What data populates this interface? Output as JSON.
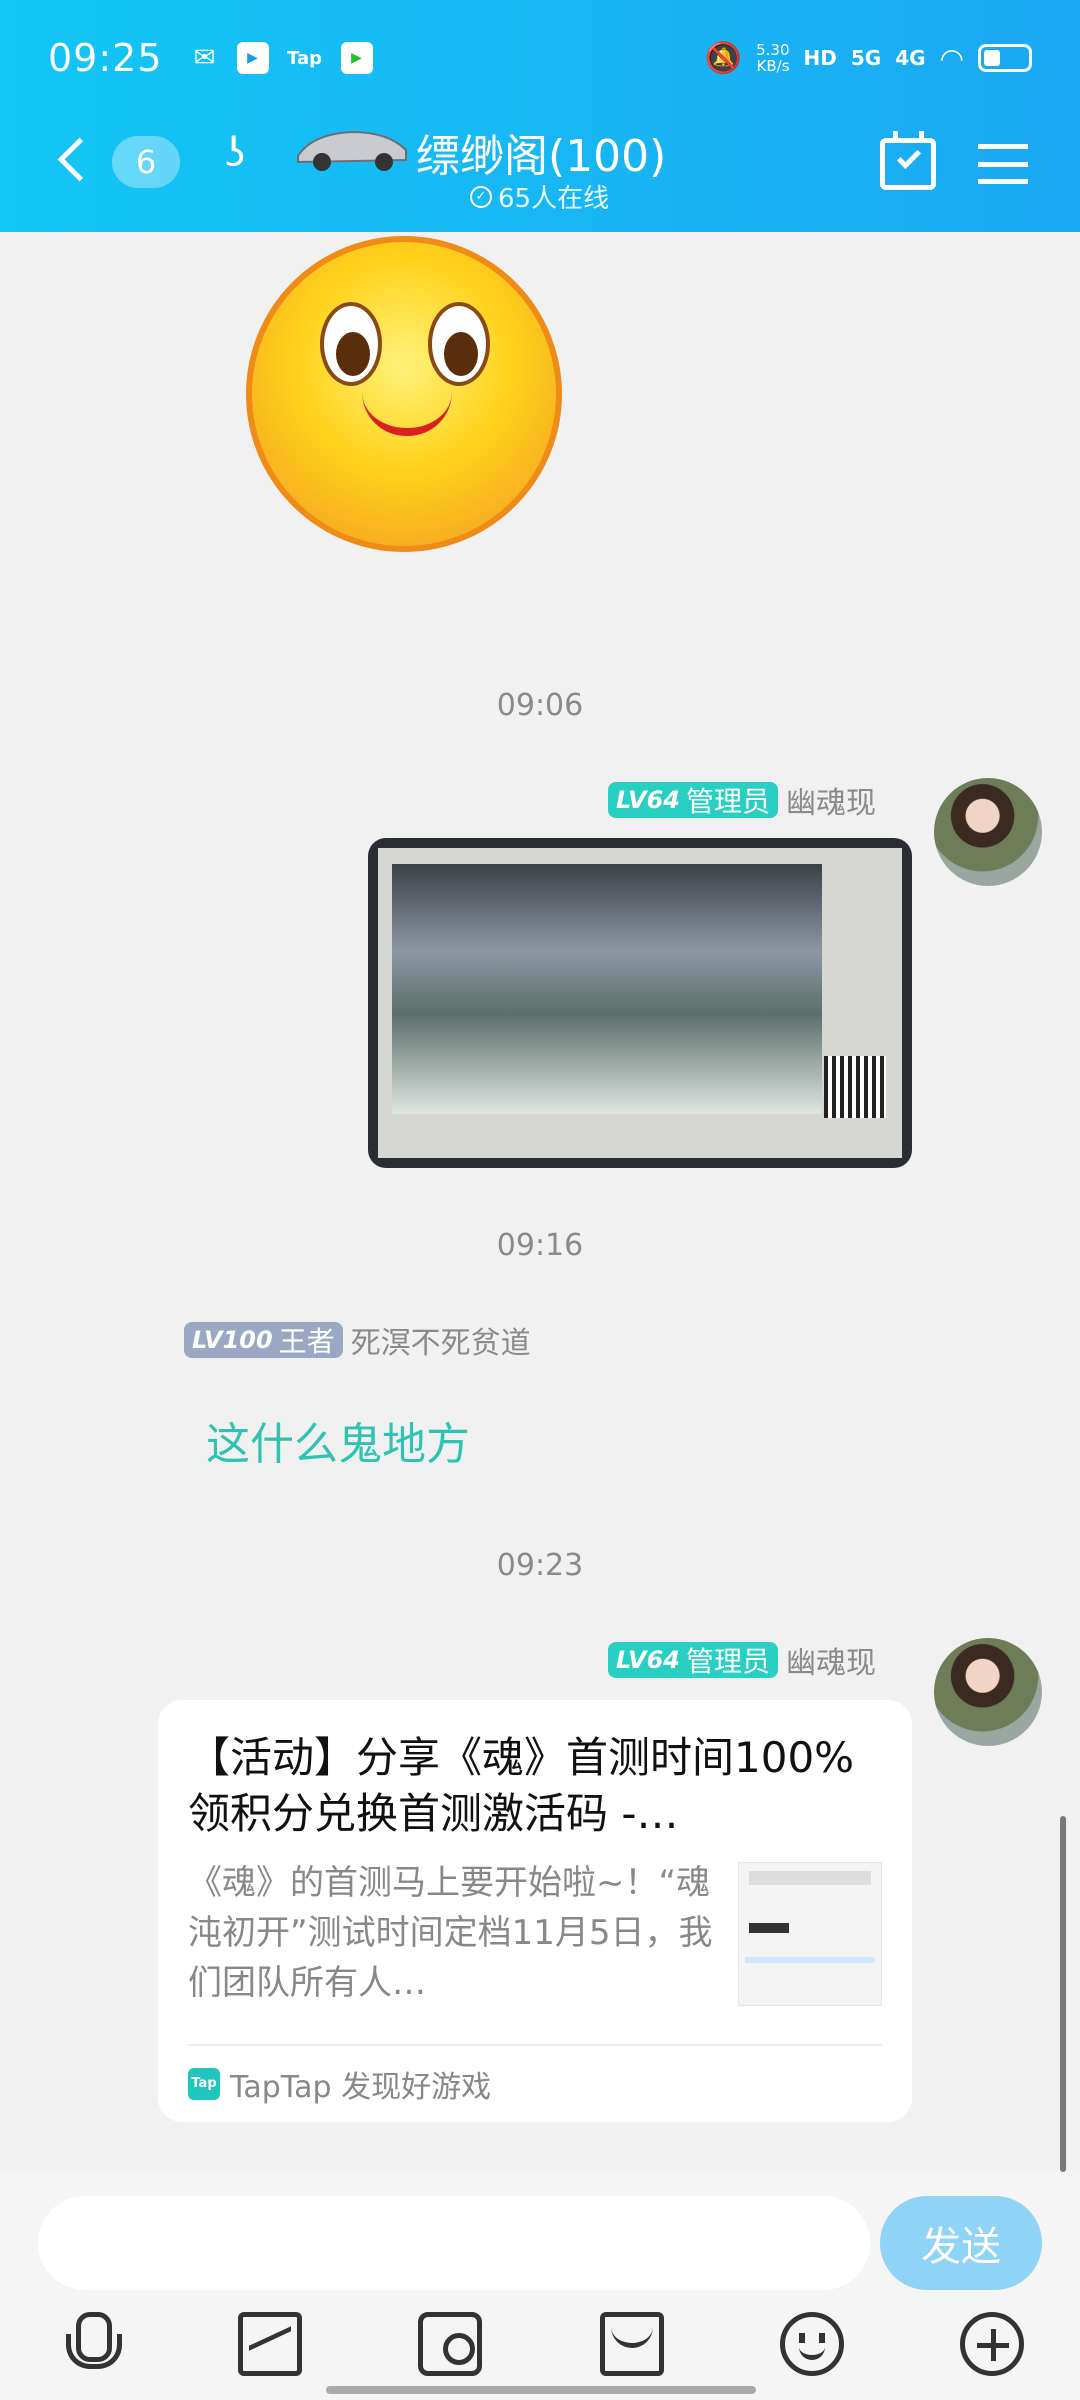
{
  "status_bar": {
    "time": "09:25",
    "app_icons": [
      "wechat-icon",
      "youku-icon",
      "tap-icon",
      "iqiyi-icon"
    ],
    "tap_label": "Tap",
    "net_speed_value": "5.30",
    "net_speed_unit": "KB/s",
    "hd_label": "HD",
    "signal1": "5G",
    "signal2": "4G"
  },
  "header": {
    "unread_count": "6",
    "group_title": "缥缈阁(100)",
    "online_text": "65人在线"
  },
  "messages": {
    "time1": "09:06",
    "time2": "09:16",
    "time3": "09:23",
    "admin_level": "LV64",
    "admin_role": "管理员",
    "admin_name": "幽魂现",
    "king_level": "LV100",
    "king_role": "王者",
    "king_name": "死溟不死贫道",
    "king_text": "这什么鬼地方"
  },
  "card": {
    "title": "【活动】分享《魂》首测时间100%领积分兑换首测激活码 -…",
    "description": "《魂》的首测马上要开始啦~！“魂沌初开”测试时间定档11月5日，我们团队所有人…",
    "source": "TapTap 发现好游戏",
    "source_logo": "Tap"
  },
  "input": {
    "placeholder": "",
    "send_label": "发送"
  },
  "colors": {
    "header": "#19b4f3",
    "admin_badge": "#28cfc2",
    "king_badge": "#9aa8c3",
    "king_text": "#2fc3b3",
    "send_button": "#8fd3f6"
  }
}
